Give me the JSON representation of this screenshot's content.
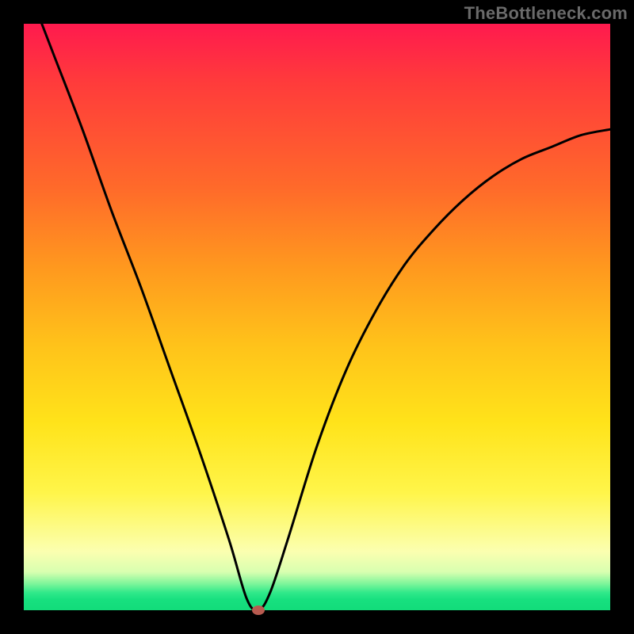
{
  "watermark": "TheBottleneck.com",
  "chart_data": {
    "type": "line",
    "title": "",
    "xlabel": "",
    "ylabel": "",
    "xlim": [
      0,
      100
    ],
    "ylim": [
      0,
      100
    ],
    "grid": false,
    "legend": false,
    "series": [
      {
        "name": "bottleneck-curve",
        "x": [
          0,
          5,
          10,
          15,
          20,
          25,
          30,
          35,
          38,
          40,
          42,
          45,
          50,
          55,
          60,
          65,
          70,
          75,
          80,
          85,
          90,
          95,
          100
        ],
        "y": [
          108,
          95,
          82,
          68,
          55,
          41,
          27,
          12,
          2,
          0,
          3,
          12,
          28,
          41,
          51,
          59,
          65,
          70,
          74,
          77,
          79,
          81,
          82
        ]
      }
    ],
    "annotations": [
      {
        "name": "optimal-point",
        "x": 40,
        "y": 0,
        "shape": "ellipse",
        "color": "#b85b50"
      }
    ],
    "background_gradient": {
      "direction": "vertical",
      "stops": [
        {
          "pos": 0.0,
          "color": "#ff1a4e"
        },
        {
          "pos": 0.55,
          "color": "#ffc31a"
        },
        {
          "pos": 0.9,
          "color": "#fbffb0"
        },
        {
          "pos": 1.0,
          "color": "#12dc7a"
        }
      ]
    }
  }
}
